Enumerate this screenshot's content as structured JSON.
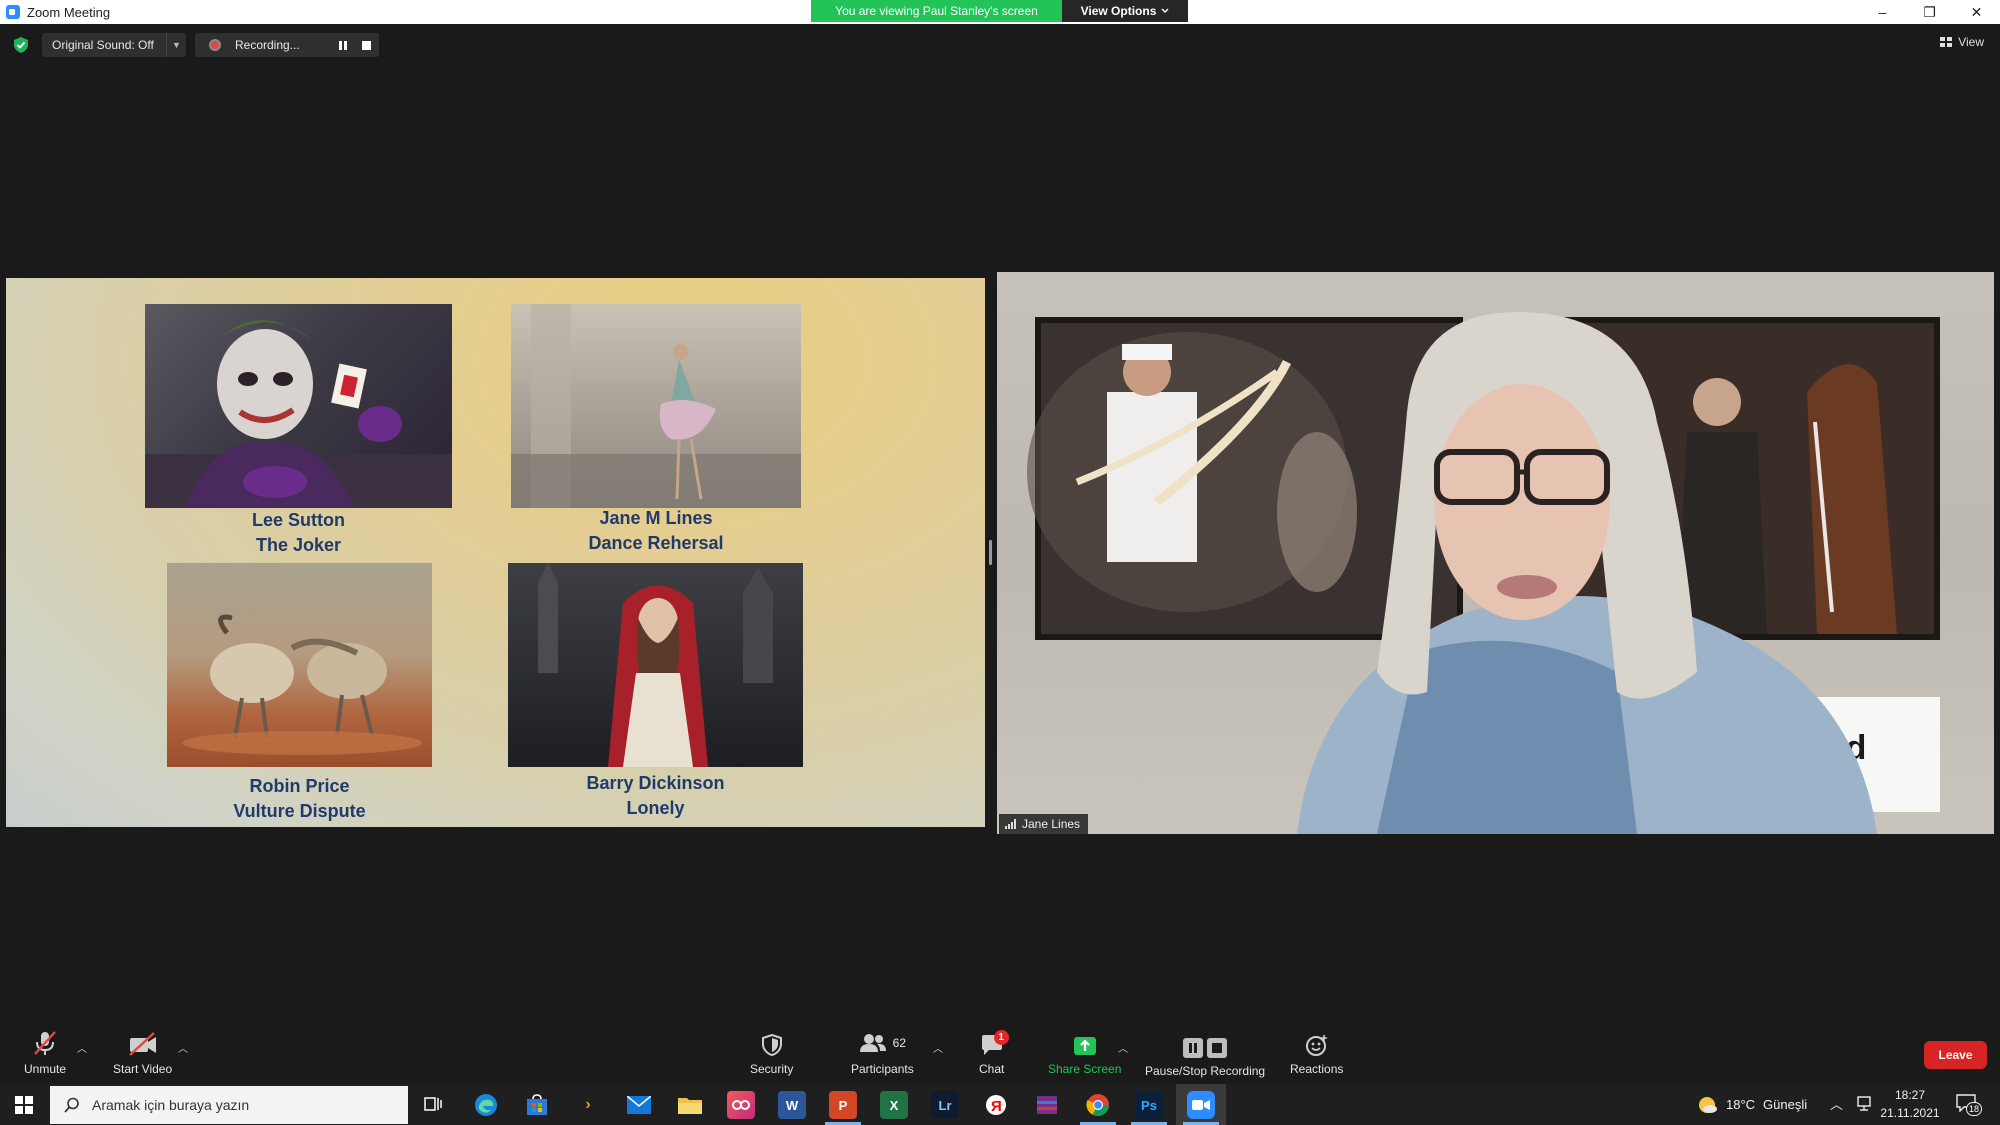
{
  "window": {
    "title": "Zoom Meeting",
    "controls": [
      "–",
      "❐",
      "✕"
    ]
  },
  "banner": {
    "viewing": "You are viewing Paul Stanley's screen",
    "view_options": "View Options"
  },
  "top_toolbar": {
    "original_sound": "Original Sound: Off",
    "recording": "Recording...",
    "view": "View"
  },
  "shared_screen": {
    "entries": [
      {
        "author": "Lee Sutton",
        "title": "The Joker"
      },
      {
        "author": "Jane M Lines",
        "title": "Dance Rehersal"
      },
      {
        "author": "Robin Price",
        "title": "Vulture Dispute"
      },
      {
        "author": "Barry Dickinson",
        "title": "Lonely"
      }
    ]
  },
  "video": {
    "participant_name": "Jane Lines",
    "banner_text": "peed"
  },
  "meeting_controls": {
    "unmute": "Unmute",
    "start_video": "Start Video",
    "security": "Security",
    "participants": "Participants",
    "participants_count": "62",
    "chat": "Chat",
    "chat_badge": "1",
    "share_screen": "Share Screen",
    "pause_stop_recording": "Pause/Stop Recording",
    "reactions": "Reactions",
    "leave": "Leave"
  },
  "taskbar": {
    "search_placeholder": "Aramak için buraya yazın",
    "weather_temp": "18°C",
    "weather_text": "Güneşli",
    "time": "18:27",
    "date": "21.11.2021",
    "notifications": "18",
    "apps": {
      "lightroom": "Lr",
      "photoshop": "Ps"
    }
  },
  "colors": {
    "banner_green": "#24c35a",
    "caption_blue": "#1f3a6b",
    "leave_red": "#d72424",
    "share_green": "#24c35a",
    "background": "#1a1a1a"
  }
}
